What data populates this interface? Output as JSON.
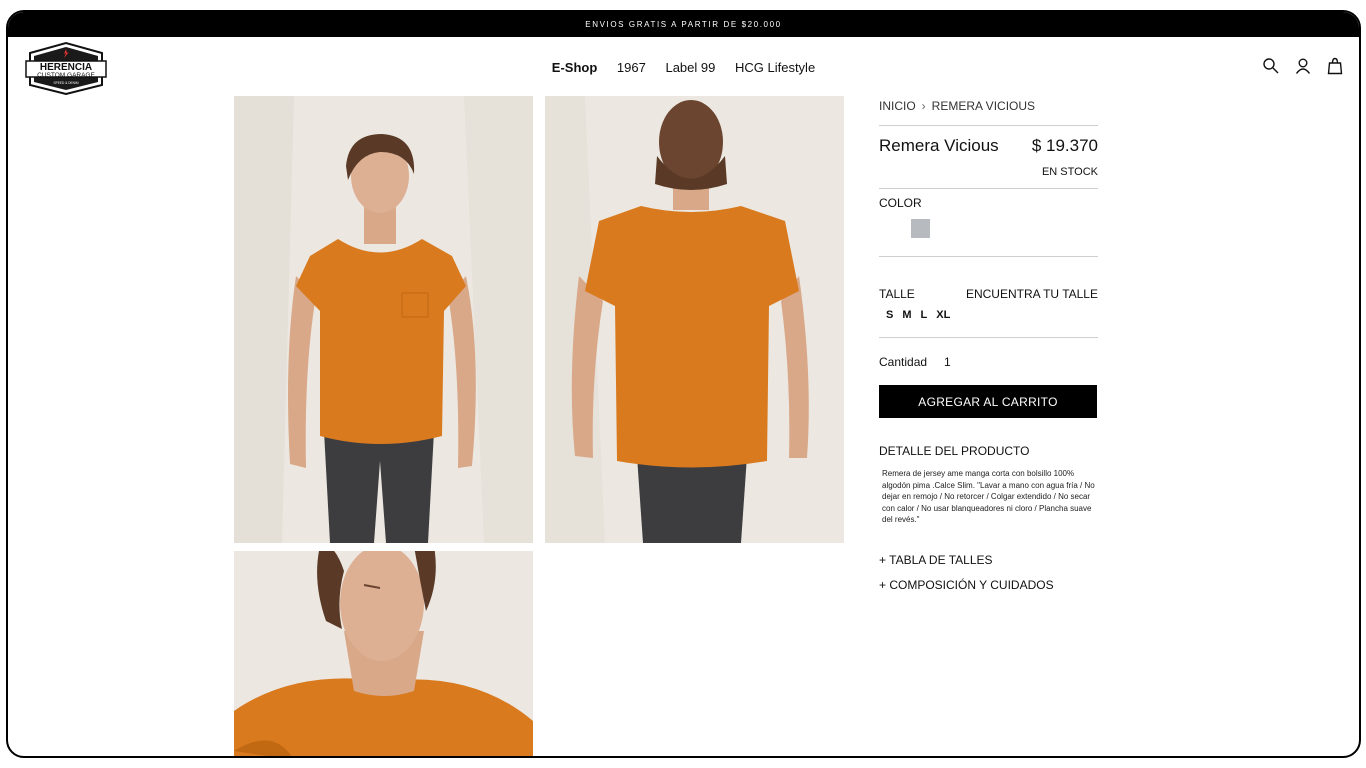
{
  "announcement": "ENVIOS GRATIS A PARTIR DE $20.000",
  "logo": {
    "line1": "HERENCIA",
    "line2": "CUSTOM GARAGE",
    "line3": "SPEED & DENIM"
  },
  "nav": {
    "items": [
      "E-Shop",
      "1967",
      "Label 99",
      "HCG Lifestyle"
    ],
    "active": "E-Shop"
  },
  "header_icons": [
    "search-icon",
    "user-icon",
    "bag-icon"
  ],
  "breadcrumb": {
    "home": "INICIO",
    "separator": "›",
    "current": "REMERA VICIOUS"
  },
  "product": {
    "title": "Remera Vicious",
    "price": "$ 19.370",
    "stock": "EN STOCK",
    "color_label": "COLOR",
    "color_swatch": "#b7bbbf",
    "size_label": "TALLE",
    "size_guide_link": "ENCUENTRA TU TALLE",
    "sizes": [
      "S",
      "M",
      "L",
      "XL"
    ],
    "quantity_label": "Cantidad",
    "quantity_value": "1",
    "add_to_cart": "AGREGAR AL CARRITO",
    "detail_title": "DETALLE DEL PRODUCTO",
    "detail_text": "Remera de jersey  ame manga corta con bolsillo 100% algodón pima .Calce Slim. \"Lavar a mano con agua fría / No dejar en remojo / No retorcer / Colgar extendido / No secar con calor / No usar blanqueadores ni cloro / Plancha suave del revés.\"",
    "accordion_1": "+ TABLA DE TALLES",
    "accordion_2": "+ COMPOSICIÓN Y CUIDADOS"
  },
  "colors": {
    "shirt": "#d97a1f",
    "backdrop": "#ece8e1",
    "jeans": "#3d3d40",
    "skin": "#d9a888",
    "hair": "#5a3a26"
  }
}
